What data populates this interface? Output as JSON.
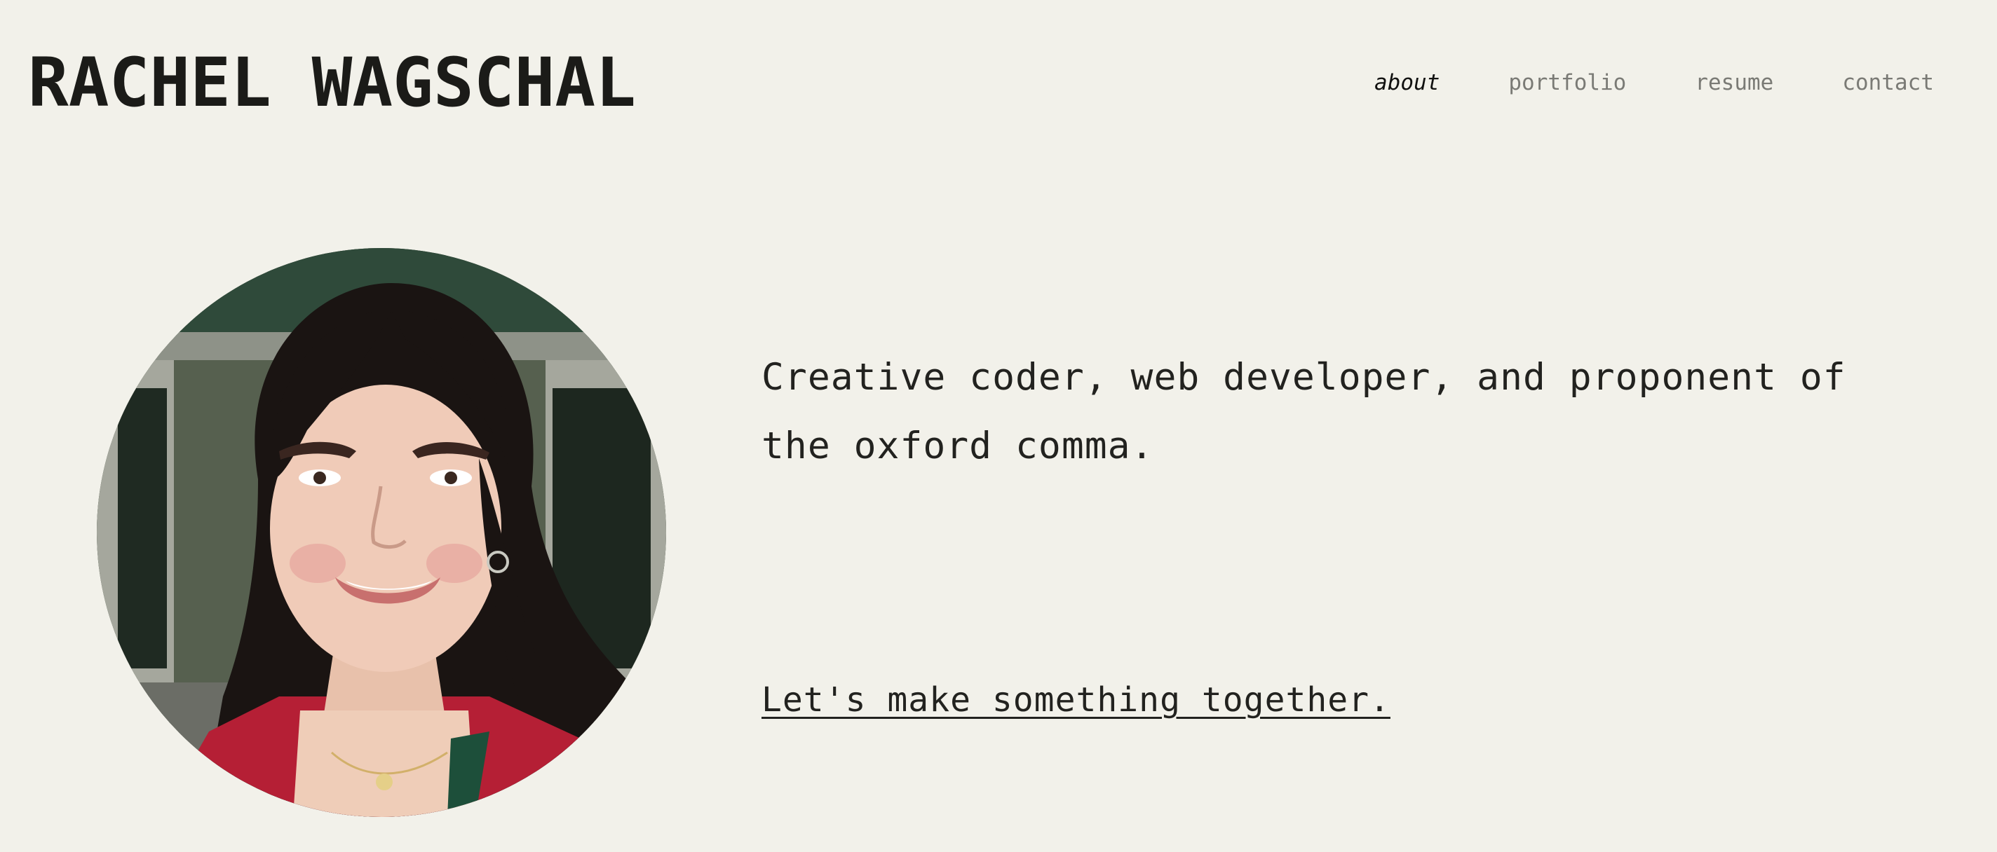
{
  "header": {
    "site_title": "RACHEL WAGSCHAL"
  },
  "nav": {
    "items": [
      {
        "label": "about",
        "active": true
      },
      {
        "label": "portfolio",
        "active": false
      },
      {
        "label": "resume",
        "active": false
      },
      {
        "label": "contact",
        "active": false
      }
    ]
  },
  "hero": {
    "portrait_icon": "portrait-photo",
    "tagline": "Creative coder, web developer, and proponent of the oxford comma.",
    "cta_label": "Let's make something together."
  },
  "colors": {
    "background": "#f2f1ea",
    "text": "#1b1b18",
    "nav_inactive": "#7a7a75"
  }
}
